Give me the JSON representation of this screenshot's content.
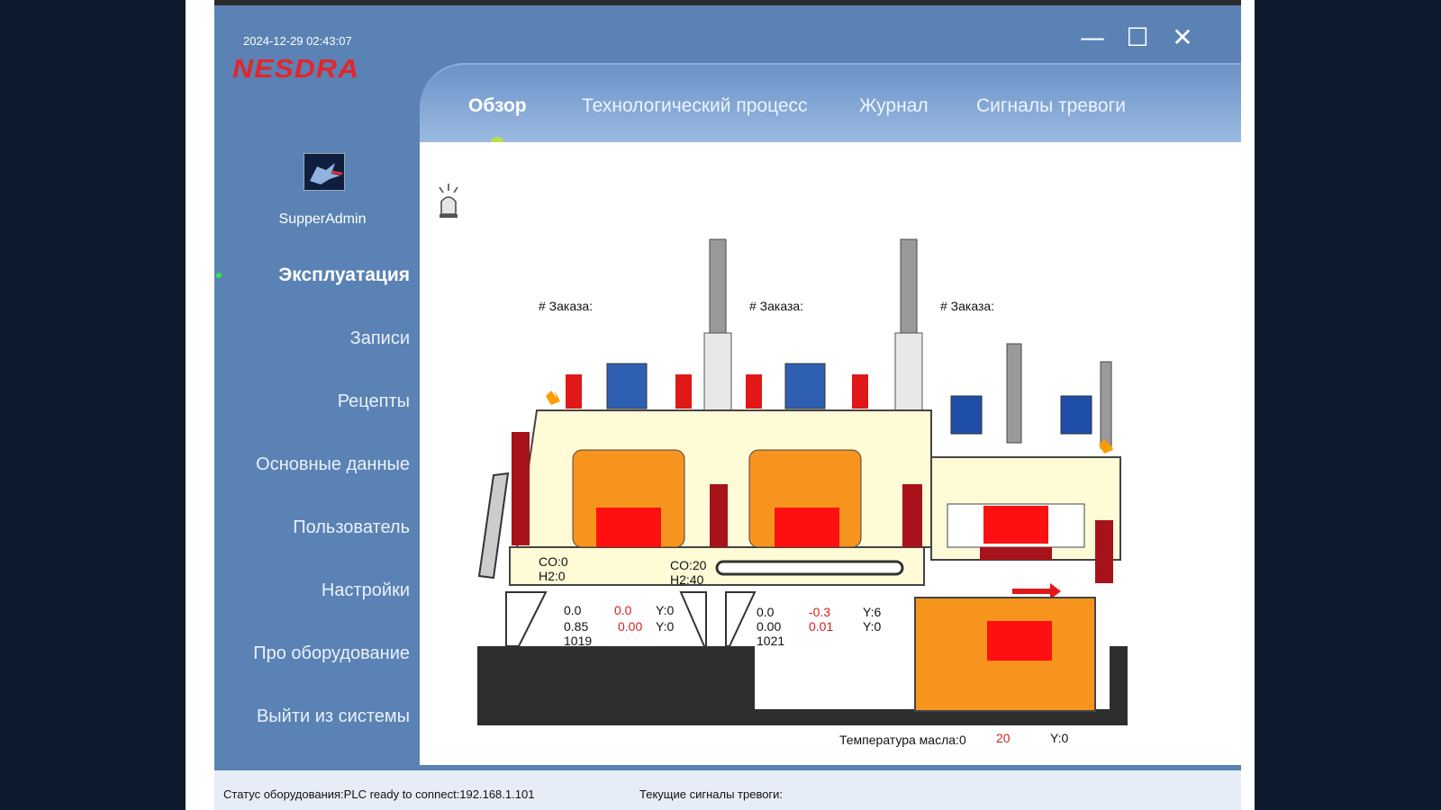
{
  "header": {
    "datetime": "2024-12-29 02:43:07",
    "logo": "NESDRA",
    "window_controls": {
      "minimize": "—",
      "maximize": "☐",
      "close": "✕"
    }
  },
  "tabs": [
    {
      "label": "Обзор",
      "active": true
    },
    {
      "label": "Технологический процесс",
      "active": false
    },
    {
      "label": "Журнал",
      "active": false
    },
    {
      "label": "Сигналы тревоги",
      "active": false
    }
  ],
  "sidebar": {
    "username": "SupperAdmin",
    "items": [
      {
        "label": "Эксплуатация",
        "active": true
      },
      {
        "label": "Записи"
      },
      {
        "label": "Рецепты"
      },
      {
        "label": "Основные данные"
      },
      {
        "label": "Пользователь"
      },
      {
        "label": "Настройки"
      },
      {
        "label": "Про оборудование"
      },
      {
        "label": "Выйти из системы"
      }
    ]
  },
  "process": {
    "order_labels": [
      "# Заказа:",
      "# Заказа:",
      "# Заказа:"
    ],
    "gas1": {
      "co": "CO:0",
      "h2": "H2:0"
    },
    "gas2": {
      "co": "CO:20",
      "h2": "H2:40"
    },
    "zone1": {
      "v1": "0.0",
      "v1_red": "0.0",
      "y1": "Y:0",
      "v2": "0.85",
      "v2_red": "0.00",
      "y2": "Y:0",
      "v3": "1019"
    },
    "zone2": {
      "v1": "0.0",
      "v1_red": "-0.3",
      "y1": "Y:6",
      "v2": "0.00",
      "v2_red": "0.01",
      "y2": "Y:0",
      "v3": "1021"
    },
    "oil": {
      "label": "Температура масла:0",
      "value_red": "20",
      "y": "Y:0"
    }
  },
  "status": {
    "equipment": "Статус оборудования:PLC ready to connect:192.168.1.101",
    "alarms": "Текущие сигналы тревоги:"
  },
  "colors": {
    "sidebar": "#5a82b4",
    "accent_red": "#e3262a",
    "chamber_orange": "#f7941d",
    "furnace_body": "#fffbd6",
    "floor": "#2e2e2e"
  }
}
